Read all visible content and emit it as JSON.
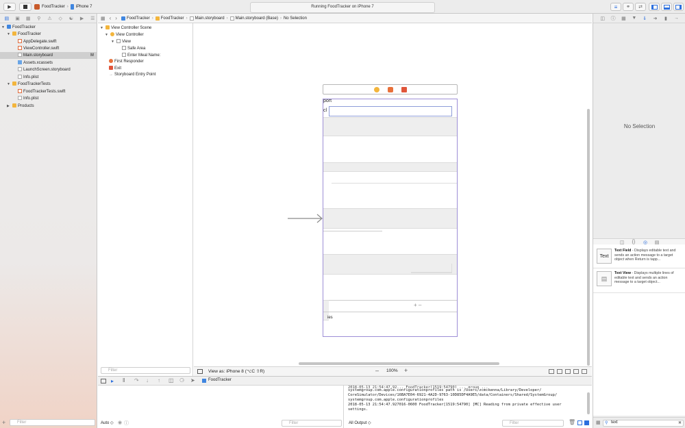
{
  "toolbar": {
    "scheme_app": "FoodTracker",
    "scheme_device": "iPhone 7",
    "status": "Running FoodTracker on iPhone 7"
  },
  "navigator": {
    "items": [
      {
        "label": "FoodTracker",
        "icon": "project-icon",
        "indent": 0,
        "disclosure": "open"
      },
      {
        "label": "FoodTracker",
        "icon": "folder-icon",
        "indent": 1,
        "disclosure": "open"
      },
      {
        "label": "AppDelegate.swift",
        "icon": "swift-file-icon",
        "indent": 2
      },
      {
        "label": "ViewController.swift",
        "icon": "swift-file-icon",
        "indent": 2
      },
      {
        "label": "Main.storyboard",
        "icon": "storyboard-icon",
        "indent": 2,
        "selected": true,
        "badge": "M"
      },
      {
        "label": "Assets.xcassets",
        "icon": "assets-icon",
        "indent": 2
      },
      {
        "label": "LaunchScreen.storyboard",
        "icon": "storyboard-icon",
        "indent": 2
      },
      {
        "label": "Info.plist",
        "icon": "plist-icon",
        "indent": 2
      },
      {
        "label": "FoodTrackerTests",
        "icon": "folder-icon",
        "indent": 1,
        "disclosure": "open"
      },
      {
        "label": "FoodTrackerTests.swift",
        "icon": "swift-file-icon",
        "indent": 2
      },
      {
        "label": "Info.plist",
        "icon": "plist-icon",
        "indent": 2
      },
      {
        "label": "Products",
        "icon": "folder-icon",
        "indent": 1,
        "disclosure": "closed"
      }
    ],
    "filter_placeholder": "Filter"
  },
  "jumpbar": {
    "crumbs": [
      "FoodTracker",
      "FoodTracker",
      "Main.storyboard",
      "Main.storyboard (Base)",
      "No Selection"
    ]
  },
  "outline": {
    "items": [
      {
        "label": "View Controller Scene",
        "icon": "scene-icon"
      },
      {
        "label": "View Controller",
        "icon": "view-controller-icon"
      },
      {
        "label": "View",
        "icon": "view-icon"
      },
      {
        "label": "Safe Area",
        "icon": "safe-area-icon"
      },
      {
        "label": "Enter Meal Name:",
        "icon": "text-field-icon"
      },
      {
        "label": "First Responder",
        "icon": "first-responder-icon"
      },
      {
        "label": "Exit",
        "icon": "exit-icon"
      },
      {
        "label": "Storyboard Entry Point",
        "icon": "entry-point-icon"
      }
    ],
    "filter_placeholder": "Filter"
  },
  "canvas": {
    "scene_label_fragment": "port",
    "scene_letter": "cl",
    "scene_bottom_text": "ies",
    "view_as": "View as: iPhone 8 (⌥C ⇧R)",
    "zoom": "100%"
  },
  "debug": {
    "target": "FoodTracker",
    "auto_label": "Auto ◇",
    "filter_placeholder": "Filter",
    "output_label": "All Output ◇",
    "console_lines": [
      "2018-05-13 21:54:47.92... FoodTracker[1519:54790] ... group ...",
      "systemgroup.com.apple.configurationprofiles path is /Users/zcmckenna/Library/Developer/",
      "CoreSimulator/Devices/16BA7E04-6921-4A2D-9763-10D85DF4A9E5/data/Containers/Shared/SystemGroup/",
      "systemgroup.com.apple.configurationprofiles",
      "2018-05-13 21:54:47.927016-0600 FoodTracker[1519:54790] [MC] Reading from private effective user",
      "settings."
    ]
  },
  "inspector": {
    "empty_label": "No Selection",
    "library": [
      {
        "thumb": "Text",
        "title": "Text Field",
        "desc": " - Displays editable text and sends an action message to a target object when Return is tapp..."
      },
      {
        "thumb": "",
        "title": "Text View",
        "desc": " - Displays multiple lines of editable text and sends an action message to a target object..."
      }
    ],
    "search_value": "text"
  }
}
